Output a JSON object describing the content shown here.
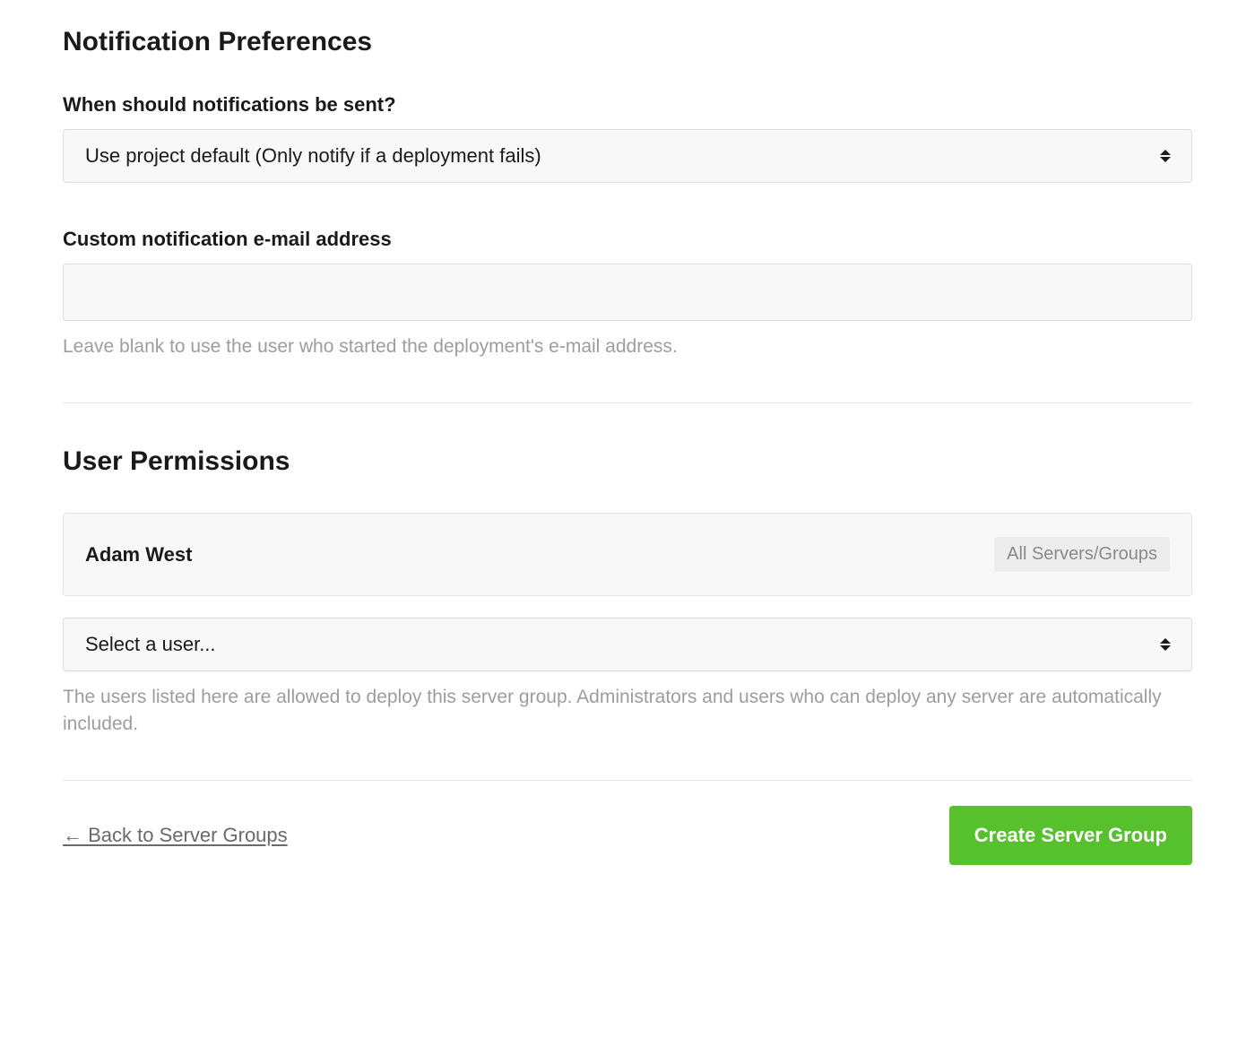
{
  "notification": {
    "heading": "Notification Preferences",
    "whenLabel": "When should notifications be sent?",
    "whenValue": "Use project default (Only notify if a deployment fails)",
    "customEmailLabel": "Custom notification e-mail address",
    "customEmailValue": "",
    "customEmailHelp": "Leave blank to use the user who started the deployment's e-mail address."
  },
  "permissions": {
    "heading": "User Permissions",
    "users": [
      {
        "name": "Adam West",
        "scope": "All Servers/Groups"
      }
    ],
    "selectPrompt": "Select a user...",
    "help": "The users listed here are allowed to deploy this server group. Administrators and users who can deploy any server are automatically included."
  },
  "footer": {
    "backLabel": "← Back to Server Groups",
    "submitLabel": "Create Server Group"
  }
}
